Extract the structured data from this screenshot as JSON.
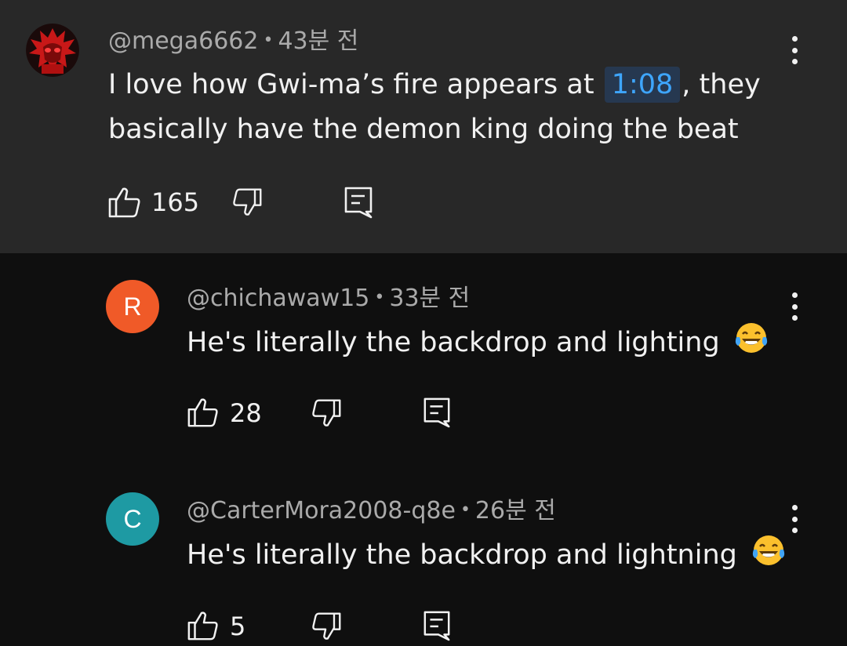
{
  "comments": [
    {
      "handle": "@mega6662",
      "time": "43분 전",
      "text_before": "I love how Gwi-ma’s fire appears at",
      "timestamp": "1:08",
      "text_after": ", they",
      "text_line2": "basically have the demon king doing the beat",
      "likes": "165"
    },
    {
      "avatar_letter": "R",
      "avatar_color": "#f05a28",
      "handle": "@chichawaw15",
      "time": "33분 전",
      "text": "He's literally the backdrop and lighting",
      "likes": "28"
    },
    {
      "avatar_letter": "C",
      "avatar_color": "#1e9aa3",
      "handle": "@CarterMora2008-q8e",
      "time": "26분 전",
      "text": "He's literally the backdrop and lightning",
      "likes": "5"
    }
  ],
  "icons": {
    "like": "thumbs-up-icon",
    "dislike": "thumbs-down-icon",
    "reply": "reply-icon",
    "more": "more-vert-icon",
    "emoji": "face-with-tears-of-joy-emoji"
  },
  "colors": {
    "parent_bg": "#282828",
    "page_bg": "#0f0f0f",
    "timestamp_link": "#3ea6ff",
    "timestamp_bg": "#263850",
    "meta_text": "#aaaaaa"
  }
}
